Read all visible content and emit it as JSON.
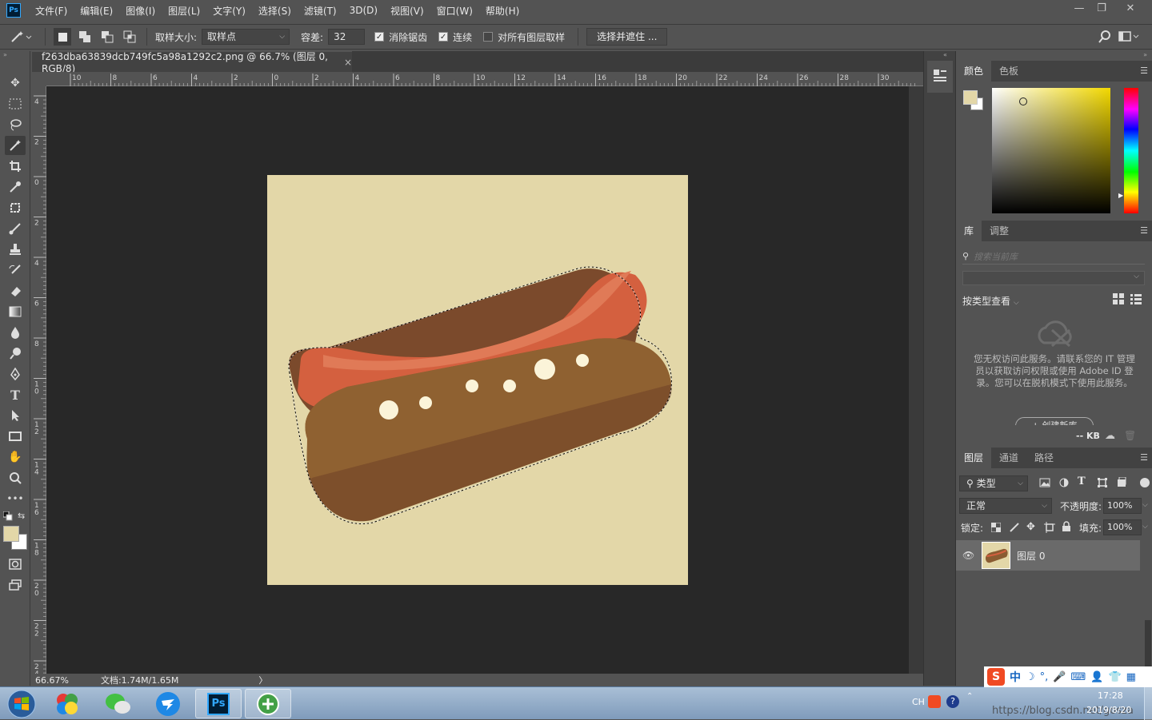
{
  "app": {
    "logo": "Ps"
  },
  "menu": [
    "文件(F)",
    "编辑(E)",
    "图像(I)",
    "图层(L)",
    "文字(Y)",
    "选择(S)",
    "滤镜(T)",
    "3D(D)",
    "视图(V)",
    "窗口(W)",
    "帮助(H)"
  ],
  "window_controls": {
    "minimize": "—",
    "restore": "❐",
    "close": "✕"
  },
  "options": {
    "sample_size_label": "取样大小:",
    "sample_size_value": "取样点",
    "tolerance_label": "容差:",
    "tolerance_value": "32",
    "antialias_label": "消除锯齿",
    "antialias_checked": true,
    "contiguous_label": "连续",
    "contiguous_checked": true,
    "all_layers_label": "对所有图层取样",
    "all_layers_checked": false,
    "select_mask_button": "选择并遮住 ..."
  },
  "document": {
    "tab_title": "f263dba63839dcb749fc5a98a1292c2.png @ 66.7% (图层 0, RGB/8)",
    "close": "×"
  },
  "ruler": {
    "h_labels": [
      "10",
      "8",
      "6",
      "4",
      "2",
      "0",
      "2",
      "4",
      "6",
      "8",
      "10",
      "12",
      "14",
      "16",
      "18",
      "20",
      "22",
      "24",
      "26",
      "28",
      "30"
    ],
    "v_labels": [
      "4",
      "2",
      "0",
      "2",
      "4",
      "6",
      "8",
      "10",
      "12",
      "14",
      "16",
      "18",
      "20",
      "22",
      "24"
    ]
  },
  "status": {
    "zoom": "66.67%",
    "doc": "文档:1.74M/1.65M",
    "arrow": "〉"
  },
  "color_panel": {
    "tabs": [
      "颜色",
      "色板"
    ],
    "foreground": "#e3d7a8",
    "background": "#ffffff",
    "hue": "#f2d800"
  },
  "library_panel": {
    "tabs": [
      "库",
      "调整"
    ],
    "search_placeholder": "搜索当前库",
    "view_label": "按类型查看",
    "message": "您无权访问此服务。请联系您的 IT 管理员以获取访问权限或使用 Adobe ID 登录。您可以在脱机模式下使用此服务。",
    "create_button": "+ 创建新库",
    "size": "-- KB"
  },
  "layers_panel": {
    "tabs": [
      "图层",
      "通道",
      "路径"
    ],
    "filter_label": "类型",
    "blend_mode": "正常",
    "opacity_label": "不透明度:",
    "opacity_value": "100%",
    "lock_label": "锁定:",
    "fill_label": "填充:",
    "fill_value": "100%",
    "layers": [
      {
        "name": "图层 0",
        "visible": true
      }
    ]
  },
  "taskbar": {
    "ime": "中",
    "lang": "CH",
    "time": "17:28",
    "date": "2019/8/20",
    "watermark": "https://blog.csdn.net/gosza"
  }
}
